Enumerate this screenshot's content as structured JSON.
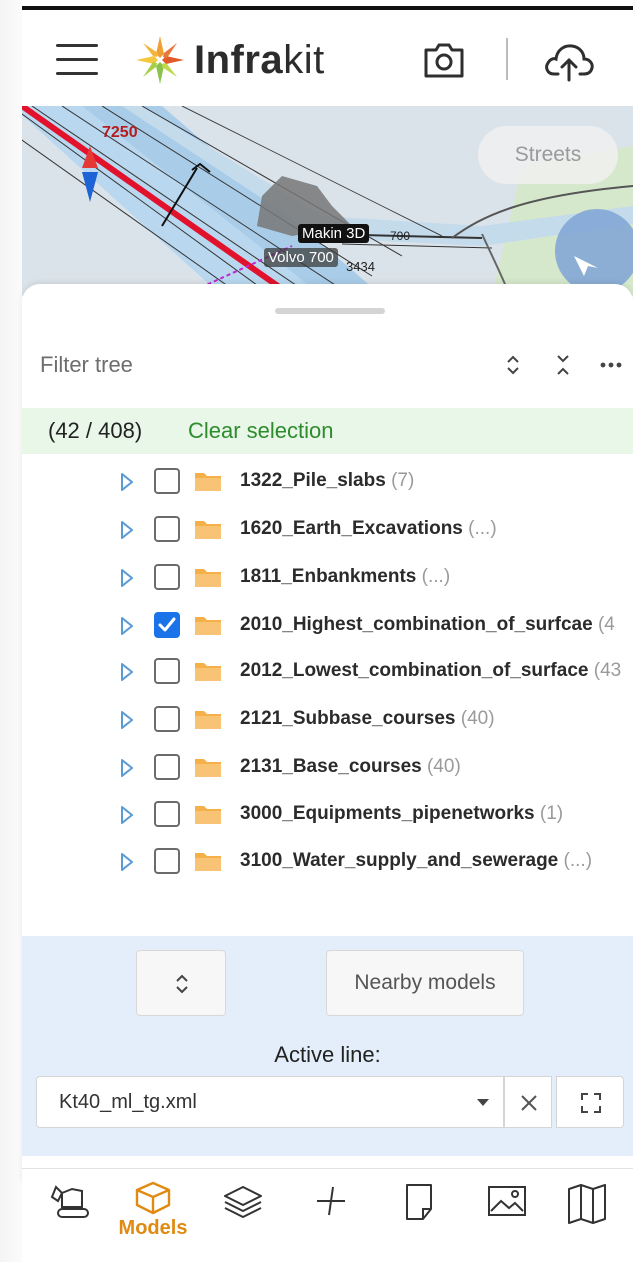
{
  "header": {
    "brand_bold": "Infra",
    "brand_light": "kit",
    "icons": {
      "menu": "hamburger-icon",
      "logo": "infrakit-logo",
      "camera": "camera-icon",
      "upload": "cloud-upload-icon"
    }
  },
  "map": {
    "streets_label": "Streets",
    "labels": {
      "station": "7250",
      "machine": "Makin 3D",
      "model": "Volvo 700",
      "side_number": "700",
      "extra": "3434"
    }
  },
  "tree": {
    "filter_placeholder": "Filter tree",
    "selection": {
      "count": "(42 / 408)",
      "clear_label": "Clear selection"
    },
    "items": [
      {
        "label": "1322_Pile_slabs",
        "count": "(7)",
        "checked": false
      },
      {
        "label": "1620_Earth_Excavations",
        "count": "(...)",
        "checked": false
      },
      {
        "label": "1811_Enbankments",
        "count": "(...)",
        "checked": false
      },
      {
        "label": "2010_Highest_combination_of_surfcae",
        "count": "(4",
        "checked": true
      },
      {
        "label": "2012_Lowest_combination_of_surface",
        "count": "(43",
        "checked": false
      },
      {
        "label": "2121_Subbase_courses",
        "count": "(40)",
        "checked": false
      },
      {
        "label": "2131_Base_courses",
        "count": "(40)",
        "checked": false
      },
      {
        "label": "3000_Equipments_pipenetworks",
        "count": "(1)",
        "checked": false
      },
      {
        "label": "3100_Water_supply_and_sewerage",
        "count": "(...)",
        "checked": false
      }
    ]
  },
  "panel": {
    "nearby_label": "Nearby models",
    "active_line_label": "Active line:",
    "active_line_value": "Kt40_ml_tg.xml"
  },
  "nav": {
    "active_label": "Models",
    "items": [
      "excavator-icon",
      "models-icon",
      "layers-icon",
      "measure-icon",
      "note-icon",
      "image-icon",
      "map-icon"
    ]
  },
  "colors": {
    "accent": "#e08a12",
    "check_blue": "#1a73e8",
    "clear_green": "#2e8b2e",
    "selection_bg": "#e8f7e8",
    "panel_bg": "#e4eefa",
    "folder": "#f5b04a"
  }
}
